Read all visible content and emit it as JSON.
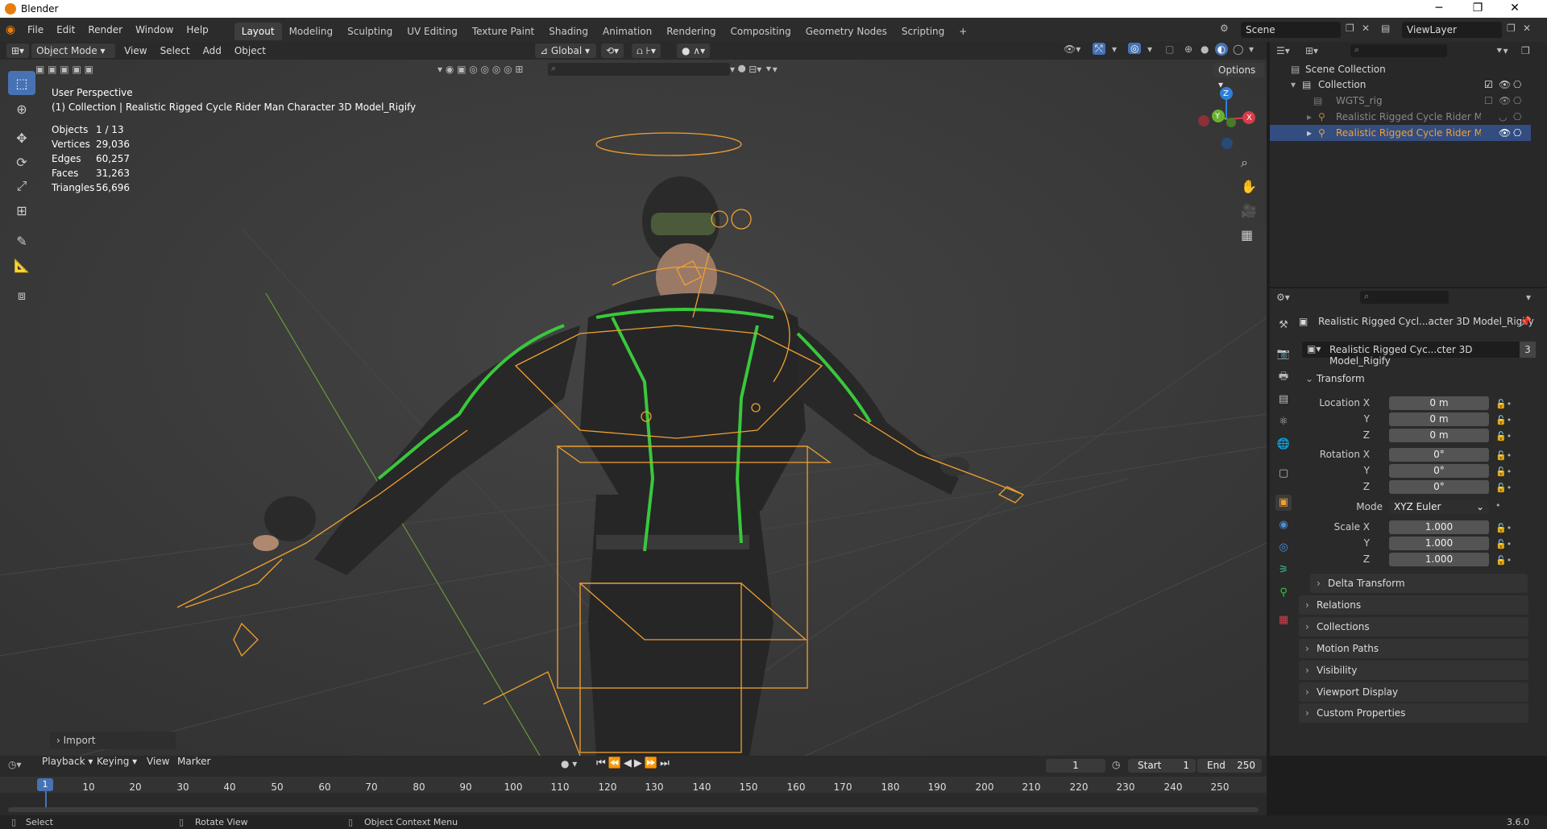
{
  "window": {
    "title": "Blender",
    "minimize": "─",
    "maximize": "❐",
    "close": "✕"
  },
  "menu": [
    "File",
    "Edit",
    "Render",
    "Window",
    "Help"
  ],
  "workspaces": [
    "Layout",
    "Modeling",
    "Sculpting",
    "UV Editing",
    "Texture Paint",
    "Shading",
    "Animation",
    "Rendering",
    "Compositing",
    "Geometry Nodes",
    "Scripting"
  ],
  "active_workspace": "Layout",
  "add_workspace": "+",
  "scene": {
    "name": "Scene",
    "view_layer": "ViewLayer"
  },
  "viewport_header": {
    "mode": "Object Mode",
    "menus": [
      "View",
      "Select",
      "Add",
      "Object"
    ],
    "orientation": "Global",
    "options": "Options"
  },
  "viewport": {
    "perspective": "User Perspective",
    "collection_line": "(1) Collection | Realistic Rigged Cycle Rider Man Character 3D Model_Rigify",
    "stats": [
      {
        "label": "Objects",
        "value": "1 / 13"
      },
      {
        "label": "Vertices",
        "value": "29,036"
      },
      {
        "label": "Edges",
        "value": "60,257"
      },
      {
        "label": "Faces",
        "value": "31,263"
      },
      {
        "label": "Triangles",
        "value": "56,696"
      }
    ],
    "gizmo": {
      "z": "Z",
      "y": "Y",
      "x": "X"
    },
    "last_op": "Import"
  },
  "outliner": {
    "scene_collection": "Scene Collection",
    "items": [
      {
        "label": "Collection"
      },
      {
        "label": "WGTS_rig"
      },
      {
        "label": "Realistic Rigged Cycle Rider Man Ch"
      },
      {
        "label": "Realistic Rigged Cycle Rider Man Ch"
      }
    ]
  },
  "properties": {
    "object_name": "Realistic Rigged Cycl...acter 3D Model_Rigify",
    "data_name": "Realistic Rigged Cyc...cter 3D Model_Rigify",
    "users": "3",
    "transform_title": "Transform",
    "location_label": "Location X",
    "rotation_label": "Rotation X",
    "scale_label": "Scale X",
    "axis_y": "Y",
    "axis_z": "Z",
    "location": [
      "0 m",
      "0 m",
      "0 m"
    ],
    "rotation": [
      "0°",
      "0°",
      "0°"
    ],
    "mode_label": "Mode",
    "mode_value": "XYZ Euler",
    "scale": [
      "1.000",
      "1.000",
      "1.000"
    ],
    "delta": "Delta Transform",
    "panels": [
      "Relations",
      "Collections",
      "Motion Paths",
      "Visibility",
      "Viewport Display",
      "Custom Properties"
    ]
  },
  "timeline": {
    "menus": [
      "Playback",
      "Keying",
      "View",
      "Marker"
    ],
    "current_frame": "1",
    "start_label": "Start",
    "start": "1",
    "end_label": "End",
    "end": "250",
    "ticks": [
      "10",
      "20",
      "30",
      "40",
      "50",
      "60",
      "70",
      "80",
      "90",
      "100",
      "110",
      "120",
      "130",
      "140",
      "150",
      "160",
      "170",
      "180",
      "190",
      "200",
      "210",
      "220",
      "230",
      "240",
      "250"
    ],
    "cursor": "1"
  },
  "statusbar": {
    "left": "Select",
    "middle": "Rotate View",
    "right": "Object Context Menu",
    "version": "3.6.0"
  },
  "colors": {
    "accent": "#4772b3",
    "selection": "#f0a030",
    "green_bone": "#39c83c"
  }
}
